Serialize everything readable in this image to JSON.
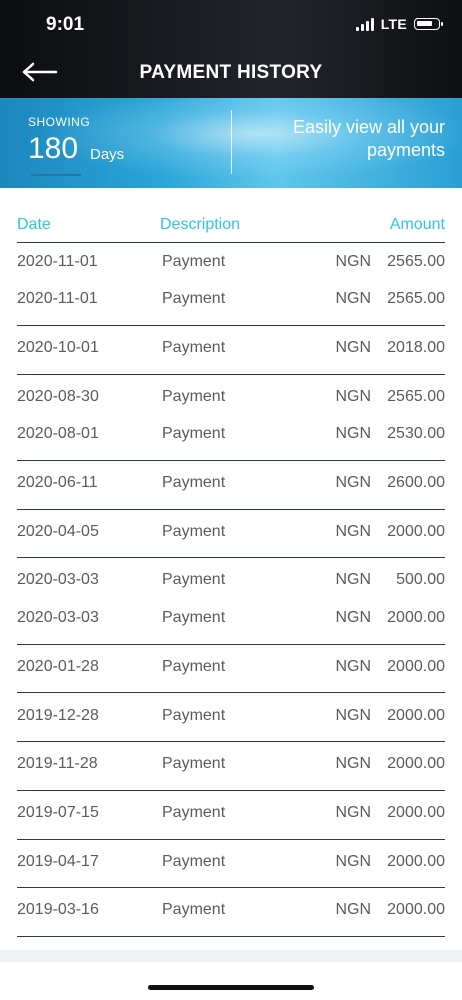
{
  "status_bar": {
    "time": "9:01",
    "network": "LTE"
  },
  "header": {
    "title": "PAYMENT HISTORY"
  },
  "banner": {
    "showing_label": "SHOWING",
    "days_value": "180",
    "days_unit": "Days",
    "tagline": "Easily view all your payments"
  },
  "table": {
    "columns": [
      "Date",
      "Description",
      "Amount"
    ],
    "rows": [
      {
        "date": "2020-11-01",
        "description": "Payment",
        "currency": "NGN",
        "amount": "2565.00"
      },
      {
        "date": "2020-11-01",
        "description": "Payment",
        "currency": "NGN",
        "amount": "2565.00"
      },
      {
        "date": "2020-10-01",
        "description": "Payment",
        "currency": "NGN",
        "amount": "2018.00"
      },
      {
        "date": "2020-08-30",
        "description": "Payment",
        "currency": "NGN",
        "amount": "2565.00"
      },
      {
        "date": "2020-08-01",
        "description": "Payment",
        "currency": "NGN",
        "amount": "2530.00"
      },
      {
        "date": "2020-06-11",
        "description": "Payment",
        "currency": "NGN",
        "amount": "2600.00"
      },
      {
        "date": "2020-04-05",
        "description": "Payment",
        "currency": "NGN",
        "amount": "2000.00"
      },
      {
        "date": "2020-03-03",
        "description": "Payment",
        "currency": "NGN",
        "amount": "500.00"
      },
      {
        "date": "2020-03-03",
        "description": "Payment",
        "currency": "NGN",
        "amount": "2000.00"
      },
      {
        "date": "2020-01-28",
        "description": "Payment",
        "currency": "NGN",
        "amount": "2000.00"
      },
      {
        "date": "2019-12-28",
        "description": "Payment",
        "currency": "NGN",
        "amount": "2000.00"
      },
      {
        "date": "2019-11-28",
        "description": "Payment",
        "currency": "NGN",
        "amount": "2000.00"
      },
      {
        "date": "2019-07-15",
        "description": "Payment",
        "currency": "NGN",
        "amount": "2000.00"
      },
      {
        "date": "2019-04-17",
        "description": "Payment",
        "currency": "NGN",
        "amount": "2000.00"
      },
      {
        "date": "2019-03-16",
        "description": "Payment",
        "currency": "NGN",
        "amount": "2000.00"
      }
    ]
  },
  "colors": {
    "accent": "#2fc6df",
    "banner": "#2aa5d8",
    "text": "#5b5b5b"
  },
  "icons": {
    "back": "back-arrow-icon",
    "signal": "signal-icon",
    "battery": "battery-icon"
  }
}
